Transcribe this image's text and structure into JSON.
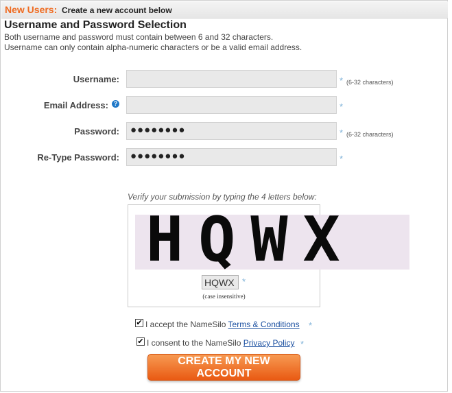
{
  "header": {
    "highlight": "New Users:",
    "subtitle": "Create a new account below"
  },
  "section": {
    "title": "Username and Password Selection",
    "desc1": "Both username and password must contain between 6 and 32 characters.",
    "desc2": "Username can only contain alpha-numeric characters or be a valid email address."
  },
  "form": {
    "username": {
      "label": "Username:",
      "value": "",
      "note": "(6-32 characters)"
    },
    "email": {
      "label": "Email Address:",
      "value": ""
    },
    "password": {
      "label": "Password:",
      "value": "●●●●●●●●",
      "note": "(6-32 characters)"
    },
    "retype": {
      "label": "Re-Type Password:",
      "value": "●●●●●●●●"
    },
    "required_mark": "*",
    "help_glyph": "?"
  },
  "captcha": {
    "instruction": "Verify your submission by typing the 4 letters below:",
    "image_text": "HQWX",
    "input_value": "HQWX",
    "note": "(case insensitive)"
  },
  "terms": {
    "checked_glyph": "✔",
    "prefix": "I accept the NameSilo",
    "link": "Terms & Conditions"
  },
  "privacy": {
    "prefix": "I consent to the NameSilo",
    "link": "Privacy Policy"
  },
  "submit": {
    "label": "CREATE MY NEW ACCOUNT"
  },
  "colors": {
    "accent": "#ef6a1f",
    "required": "#7fb2d8",
    "link": "#1a4fa0"
  }
}
